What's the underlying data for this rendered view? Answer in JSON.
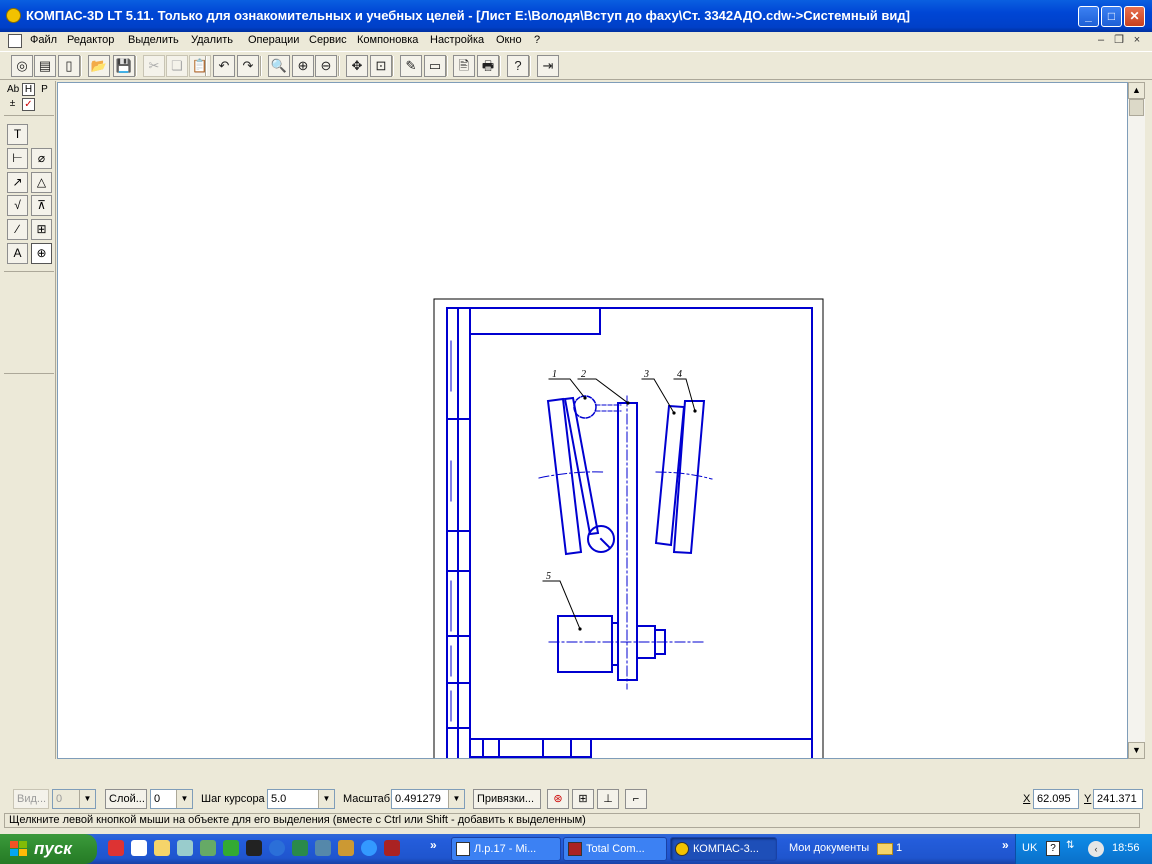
{
  "window": {
    "title": "КОМПАС-3D LT 5.11. Только для ознакомительных и учебных целей - [Лист E:\\Володя\\Вступ до фаху\\Ст. 3342АДО.cdw->Системный вид]",
    "min_label": "_",
    "max_label": "□",
    "close_label": "✕"
  },
  "menu": {
    "items": [
      "Файл",
      "Редактор",
      "Выделить",
      "Удалить",
      "Операции",
      "Сервис",
      "Компоновка",
      "Настройка",
      "Окно",
      "?"
    ],
    "mdi": [
      "–",
      "❐",
      "×"
    ]
  },
  "toolbar": {
    "buttons": [
      {
        "icon": "new-view-icon",
        "glyph": "◎",
        "enabled": true
      },
      {
        "icon": "new-sheet-icon",
        "glyph": "▤",
        "enabled": true
      },
      {
        "icon": "new-fragment-icon",
        "glyph": "▯",
        "enabled": true
      },
      {
        "icon": "open-folder-icon",
        "glyph": "📂",
        "enabled": true
      },
      {
        "icon": "save-icon",
        "glyph": "💾",
        "enabled": true
      },
      {
        "icon": "cut-icon",
        "glyph": "✂",
        "enabled": false
      },
      {
        "icon": "copy-icon",
        "glyph": "❏",
        "enabled": false
      },
      {
        "icon": "paste-icon",
        "glyph": "📋",
        "enabled": false
      },
      {
        "icon": "undo-icon",
        "glyph": "↶",
        "enabled": true
      },
      {
        "icon": "redo-icon",
        "glyph": "↷",
        "enabled": true
      },
      {
        "icon": "zoom-window-icon",
        "glyph": "🔍",
        "enabled": true
      },
      {
        "icon": "zoom-in-icon",
        "glyph": "⊕",
        "enabled": true
      },
      {
        "icon": "zoom-out-icon",
        "glyph": "⊖",
        "enabled": true
      },
      {
        "icon": "pan-icon",
        "glyph": "✥",
        "enabled": true
      },
      {
        "icon": "zoom-fit-icon",
        "glyph": "⊡",
        "enabled": true
      },
      {
        "icon": "properties-icon",
        "glyph": "✎",
        "enabled": true
      },
      {
        "icon": "layers-icon",
        "glyph": "▭",
        "enabled": true
      },
      {
        "icon": "preview-icon",
        "glyph": "🖹",
        "enabled": true
      },
      {
        "icon": "print-icon",
        "glyph": "🖶",
        "enabled": true
      },
      {
        "icon": "context-help-icon",
        "glyph": "?",
        "enabled": true
      },
      {
        "icon": "exit-icon",
        "glyph": "⇥",
        "enabled": true
      }
    ]
  },
  "palette": {
    "top_tabs": [
      {
        "icon": "text-mode-icon",
        "glyph": "Ab"
      },
      {
        "icon": "dimension-mode-icon",
        "glyph": "H"
      },
      {
        "icon": "param-mode-icon",
        "glyph": "P"
      },
      {
        "icon": "tolerance-mode-icon",
        "glyph": "±"
      },
      {
        "icon": "check-mode-icon",
        "glyph": "✓"
      }
    ],
    "tools": [
      {
        "icon": "text-tool-icon",
        "glyph": "T"
      },
      {
        "icon": "linear-dimension-icon",
        "glyph": "⊢"
      },
      {
        "icon": "diameter-dimension-icon",
        "glyph": "⌀"
      },
      {
        "icon": "radius-dimension-icon",
        "glyph": "↗"
      },
      {
        "icon": "angular-dimension-icon",
        "glyph": "△"
      },
      {
        "icon": "roughness-icon",
        "glyph": "√"
      },
      {
        "icon": "base-mark-icon",
        "glyph": "⊼"
      },
      {
        "icon": "leader-icon",
        "glyph": "∕"
      },
      {
        "icon": "table-icon",
        "glyph": "⊞"
      },
      {
        "icon": "position-leader-icon",
        "glyph": "A"
      },
      {
        "icon": "center-mark-icon",
        "glyph": "⊕"
      }
    ]
  },
  "drawing": {
    "callouts": [
      "1",
      "2",
      "3",
      "4",
      "5"
    ]
  },
  "propbar": {
    "view_label": "Вид...",
    "view_value": "0",
    "layer_label": "Слой...",
    "layer_value": "0",
    "step_label": "Шаг курсора",
    "step_value": "5.0",
    "scale_label": "Масштаб",
    "scale_value": "0.491279",
    "snaps_label": "Привязки...",
    "x_label": "X",
    "x_value": "62.095",
    "y_label": "Y",
    "y_value": "241.371"
  },
  "hint": "Щелкните левой кнопкой мыши на объекте для его выделения (вместе с Ctrl или Shift - добавить к выделенным)",
  "taskbar": {
    "start_label": "пуск",
    "tasks": [
      {
        "label": "Л.р.17 - Mi...",
        "icon": "word-icon",
        "active": false
      },
      {
        "label": "Total Com...",
        "icon": "total-commander-icon",
        "active": false
      },
      {
        "label": "КОМПАС-3...",
        "icon": "kompas-icon",
        "active": true
      }
    ],
    "docs_label": "Мои документы",
    "folder_label": "1",
    "lang": "UK",
    "clock": "18:56"
  }
}
